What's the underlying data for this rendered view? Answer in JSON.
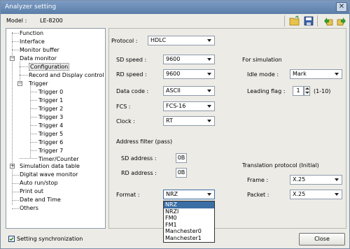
{
  "window": {
    "title": "Analyzer setting"
  },
  "toolbar": {
    "model_label": "Model :",
    "model_value": "LE-8200",
    "icons": [
      "open-folder-icon",
      "save-disk-icon",
      "import-icon",
      "export-icon"
    ]
  },
  "tree": {
    "items": [
      {
        "label": "Function"
      },
      {
        "label": "Interface"
      },
      {
        "label": "Monitor buffer"
      },
      {
        "label": "Data monitor"
      },
      {
        "label": "Configuration"
      },
      {
        "label": "Record and Display control"
      },
      {
        "label": "Trigger"
      },
      {
        "label": "Trigger 0"
      },
      {
        "label": "Trigger 1"
      },
      {
        "label": "Trigger 2"
      },
      {
        "label": "Trigger 3"
      },
      {
        "label": "Trigger 4"
      },
      {
        "label": "Trigger 5"
      },
      {
        "label": "Trigger 6"
      },
      {
        "label": "Trigger 7"
      },
      {
        "label": "Timer/Counter"
      },
      {
        "label": "Simulation data table"
      },
      {
        "label": "Digital wave monitor"
      },
      {
        "label": "Auto run/stop"
      },
      {
        "label": "Print out"
      },
      {
        "label": "Date and Time"
      },
      {
        "label": "Others"
      }
    ]
  },
  "settings": {
    "protocol": {
      "label": "Protocol :",
      "value": "HDLC"
    },
    "sd_speed": {
      "label": "SD speed :",
      "value": "9600"
    },
    "rd_speed": {
      "label": "RD speed :",
      "value": "9600"
    },
    "data_code": {
      "label": "Data code :",
      "value": "ASCII"
    },
    "fcs": {
      "label": "FCS :",
      "value": "FCS-16"
    },
    "clock": {
      "label": "Clock :",
      "value": "RT"
    },
    "address_filter_title": "Address filter (pass)",
    "sd_address": {
      "label": "SD address :",
      "value": "0B"
    },
    "rd_address": {
      "label": "RD address :",
      "value": "0B"
    },
    "format": {
      "label": "Format :",
      "value": "NRZ",
      "options": [
        "NRZ",
        "NRZI",
        "FM0",
        "FM1",
        "Manchester0",
        "Manchester1"
      ]
    },
    "simulation_title": "For simulation",
    "idle_mode": {
      "label": "Idle mode :",
      "value": "Mark"
    },
    "leading_flag": {
      "label": "Leading flag :",
      "value": "1",
      "range": "(1-10)"
    },
    "translation_title": "Translation protocol (Initial)",
    "frame": {
      "label": "Frame :",
      "value": "X.25"
    },
    "packet": {
      "label": "Packet :",
      "value": "X.25"
    }
  },
  "footer": {
    "sync_label": "Setting synchronization",
    "sync_checked": true,
    "close_label": "Close"
  },
  "colors": {
    "titlebar": "#5a7ea8",
    "selection": "#3a6ea5"
  }
}
